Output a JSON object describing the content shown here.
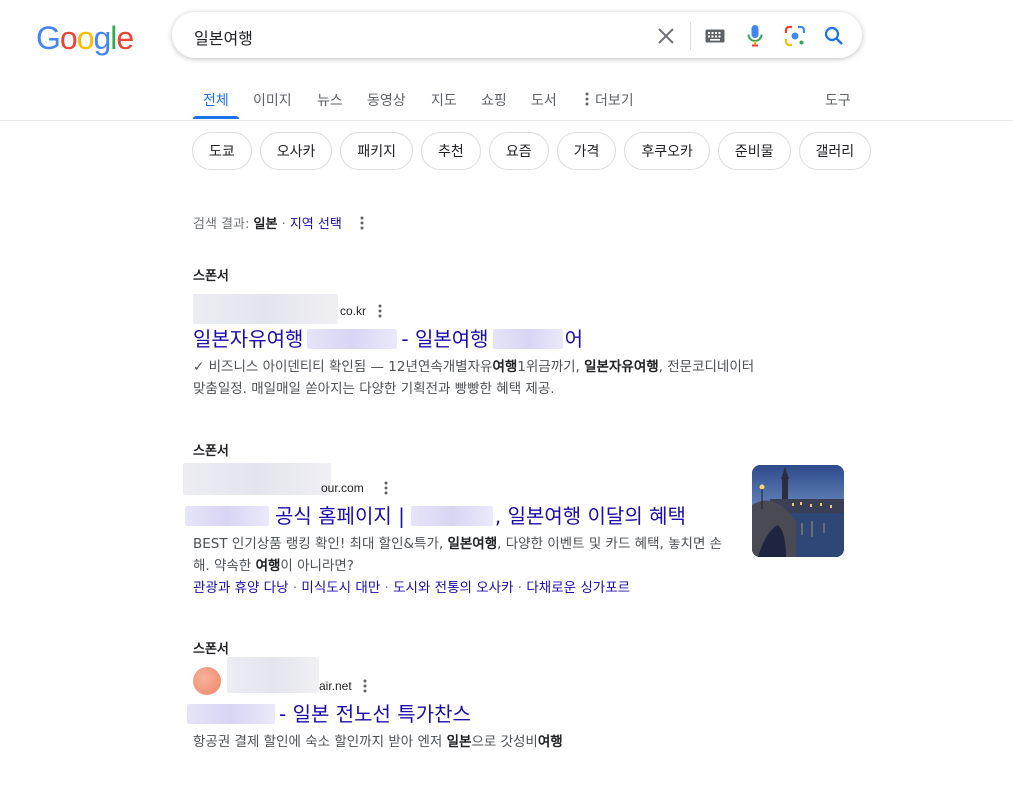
{
  "logo": {
    "letters": [
      "G",
      "o",
      "o",
      "g",
      "l",
      "e"
    ],
    "colors": [
      "#4285F4",
      "#EA4335",
      "#FBBC05",
      "#4285F4",
      "#34A853",
      "#EA4335"
    ]
  },
  "search": {
    "query": "일본여행",
    "icons": [
      "close-icon",
      "keyboard-icon",
      "mic-icon",
      "lens-icon",
      "search-icon"
    ]
  },
  "tabs": [
    {
      "label": "전체",
      "active": true
    },
    {
      "label": "이미지"
    },
    {
      "label": "뉴스"
    },
    {
      "label": "동영상"
    },
    {
      "label": "지도"
    },
    {
      "label": "쇼핑"
    },
    {
      "label": "도서"
    },
    {
      "label": "더보기"
    }
  ],
  "tools_label": "도구",
  "chips": [
    "도쿄",
    "오사카",
    "패키지",
    "추천",
    "요즘",
    "가격",
    "후쿠오카",
    "준비물",
    "갤러리"
  ],
  "region": {
    "prefix": "검색 결과:",
    "country": "일본",
    "sep": "·",
    "link": "지역 선택"
  },
  "ads": [
    {
      "sponsor": "스폰서",
      "url_suffix": "co.kr",
      "title_parts": [
        "일본자유여행",
        "- 일본여행",
        "어"
      ],
      "desc_pre": "✓ 비즈니스 아이덴티티 확인됨 — 12년연속개별자유",
      "desc_b1": "여행",
      "desc_mid": "1위금까기, ",
      "desc_b2": "일본자유여행",
      "desc_post": ", 전문코디네이터 맞춤일정. 매일매일 쏟아지는 다양한 기획전과 빵빵한 혜택 제공."
    },
    {
      "sponsor": "스폰서",
      "url_suffix": "our.com",
      "title_parts": [
        "공식 홈페이지 |",
        ", 일본여행 이달의 혜택"
      ],
      "desc_pre": "BEST 인기상품 랭킹 확인! 최대 할인&특가, ",
      "desc_b1": "일본여행",
      "desc_mid": ", 다양한 이벤트 및 카드 혜택, 놓치면 손해. 약속한 ",
      "desc_b2": "여행",
      "desc_post": "이 아니라면?",
      "sitelinks": [
        "관광과 휴양 다낭",
        "미식도시 대만",
        "도시와 전통의 오사카",
        "다채로운 싱가포르"
      ],
      "sitelink_sep": "·"
    },
    {
      "sponsor": "스폰서",
      "url_suffix": "air.net",
      "title_parts": [
        "- 일본 전노선 특가찬스"
      ],
      "desc_pre": "항공권 결제 할인에 숙소 할인까지 받아 엔저 ",
      "desc_b1": "일본",
      "desc_mid": "으로 갓성비",
      "desc_b2": "여행",
      "desc_post": ""
    }
  ]
}
